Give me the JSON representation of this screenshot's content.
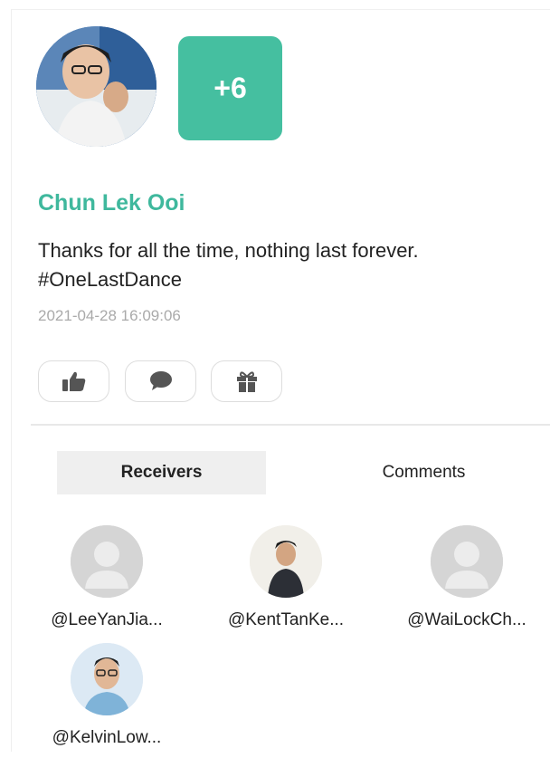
{
  "post": {
    "author_name": "Chun Lek Ooi",
    "extra_count": "+6",
    "text_line1": "Thanks for all the time, nothing last forever.",
    "text_line2": "#OneLastDance",
    "timestamp": "2021-04-28 16:09:06"
  },
  "actions": [
    {
      "icon": "thumbs-up-icon"
    },
    {
      "icon": "comment-bubble-icon"
    },
    {
      "icon": "gift-icon"
    }
  ],
  "tabs": [
    {
      "label": "Receivers",
      "active": true
    },
    {
      "label": "Comments",
      "active": false
    }
  ],
  "receivers": [
    {
      "name": "@LeeYanJia...",
      "avatar": "placeholder-avatar-icon"
    },
    {
      "name": "@KentTanKe...",
      "avatar": "photo"
    },
    {
      "name": "@WaiLockCh...",
      "avatar": "placeholder-avatar-icon"
    },
    {
      "name": "@KelvinLow...",
      "avatar": "photo"
    }
  ],
  "colors": {
    "accent": "#3fb89d",
    "badge": "#45bfa0",
    "timestamp": "#aaaaaa",
    "tab_active_bg": "#efefef"
  }
}
